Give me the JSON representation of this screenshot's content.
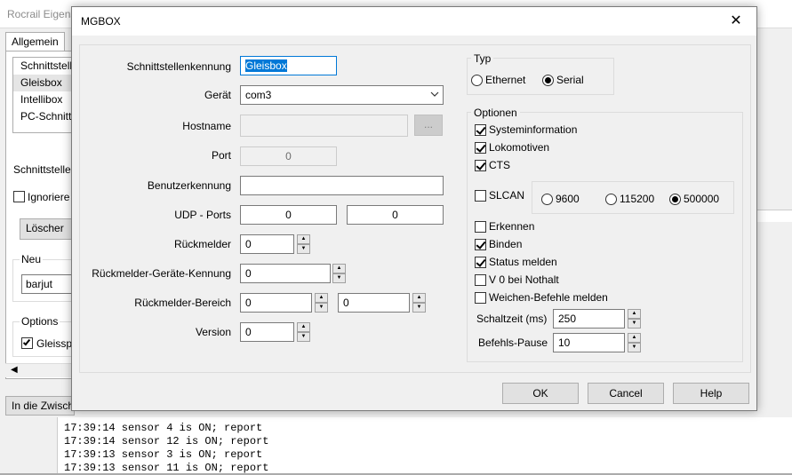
{
  "background": {
    "window_title": "Rocrail Eigensch",
    "tab": "Allgemein",
    "list_items": [
      "Schnittstell",
      "Gleisbox",
      "Intellibox",
      "PC-Schnitt"
    ],
    "schnittstellen_label": "Schnittsteller",
    "ignoriere_label": "Ignoriere",
    "loeschen_button": "Löscher",
    "neu_label": "Neu",
    "neu_value": "barjut",
    "options_label": "Options",
    "gleisspa_label": "Gleisspa",
    "bottom_button": "In die Zwisch",
    "log_lines": [
      "17:39:14 sensor 4 is ON; report",
      "17:39:14 sensor 12 is ON; report",
      "17:39:13 sensor 3 is ON; report",
      "17:39:13 sensor 11 is ON; report"
    ]
  },
  "dialog": {
    "title": "MGBOX",
    "close_glyph": "✕",
    "fields": {
      "kennung_label": "Schnittstellenkennung",
      "kennung_value": "Gleisbox",
      "geraet_label": "Gerät",
      "geraet_value": "com3",
      "hostname_label": "Hostname",
      "hostname_value": "",
      "hostname_button": "...",
      "port_label": "Port",
      "port_value": "0",
      "benutzer_label": "Benutzerkennung",
      "benutzer_value": "",
      "udp_label": "UDP - Ports",
      "udp_value1": "0",
      "udp_value2": "0",
      "rueckmelder_label": "Rückmelder",
      "rueckmelder_value": "0",
      "rm_geraete_label": "Rückmelder-Geräte-Kennung",
      "rm_geraete_value": "0",
      "rm_bereich_label": "Rückmelder-Bereich",
      "rm_bereich_value1": "0",
      "rm_bereich_value2": "0",
      "version_label": "Version",
      "version_value": "0"
    },
    "typ": {
      "legend": "Typ",
      "ethernet": "Ethernet",
      "serial": "Serial"
    },
    "optionen": {
      "legend": "Optionen",
      "systeminformation": "Systeminformation",
      "lokomotiven": "Lokomotiven",
      "cts": "CTS",
      "slcan": "SLCAN",
      "baud_9600": "9600",
      "baud_115200": "115200",
      "baud_500000": "500000",
      "erkennen": "Erkennen",
      "binden": "Binden",
      "status_melden": "Status melden",
      "v0_nothalt": "V 0 bei Nothalt",
      "weichen_befehle": "Weichen-Befehle melden",
      "schaltzeit_label": "Schaltzeit (ms)",
      "schaltzeit_value": "250",
      "befehls_pause_label": "Befehls-Pause",
      "befehls_pause_value": "10"
    },
    "buttons": {
      "ok": "OK",
      "cancel": "Cancel",
      "help": "Help"
    }
  }
}
